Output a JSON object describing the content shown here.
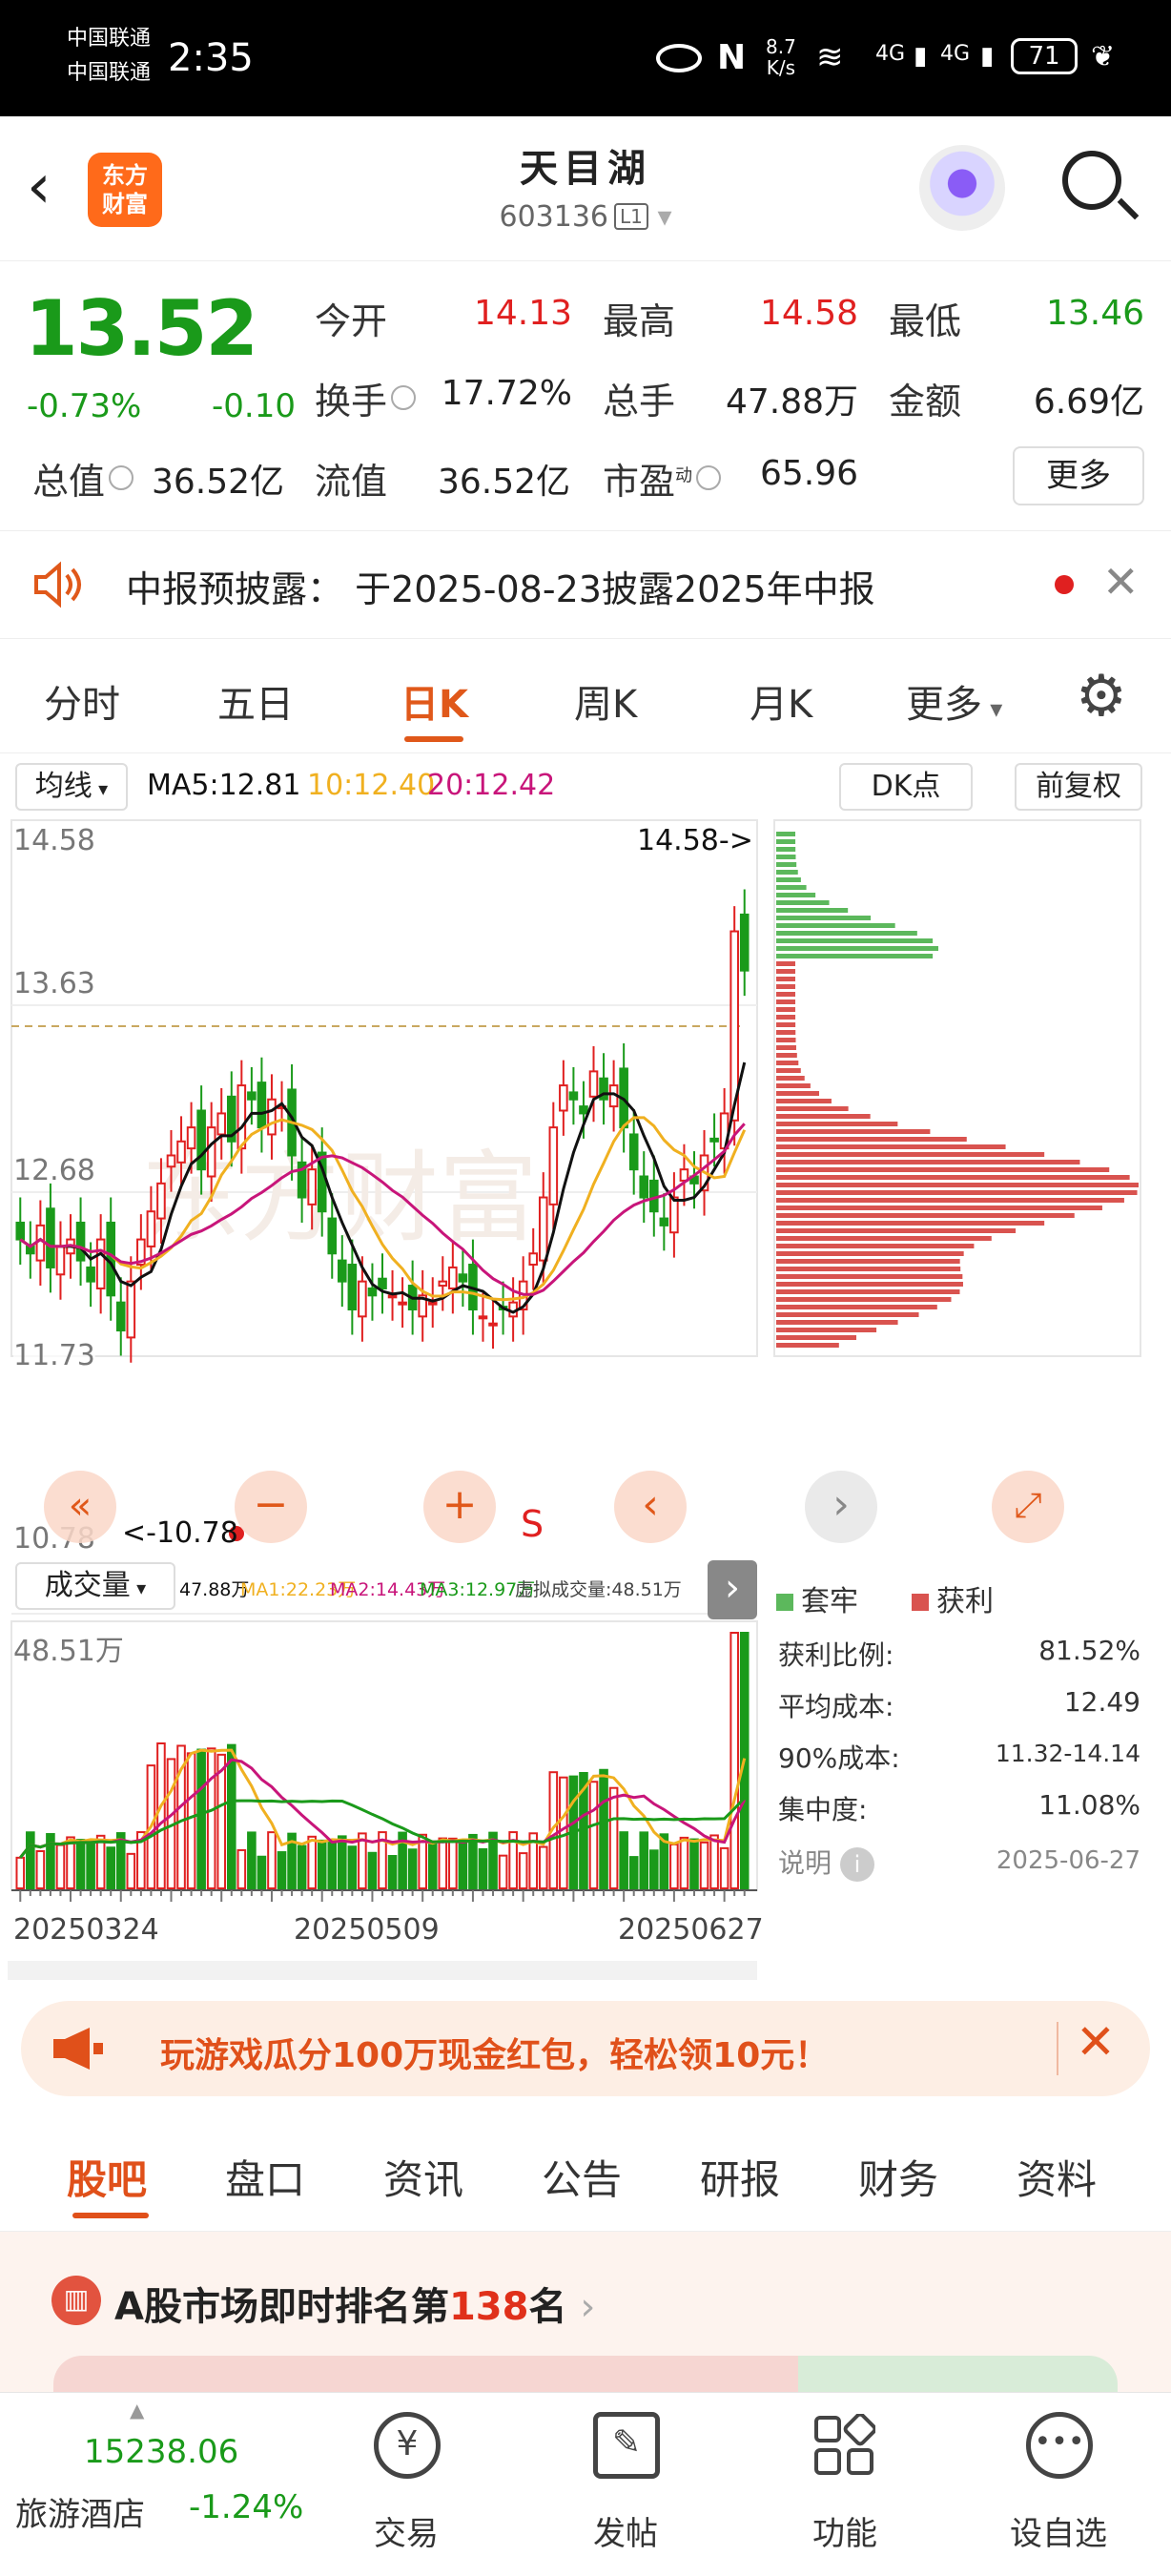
{
  "status_bar": {
    "carrier1": "中国联通",
    "carrier2": "中国联通",
    "time": "2:35",
    "speed": "8.7",
    "speed_unit": "K/s",
    "sig1": "4G",
    "sig2": "4G",
    "battery": "71"
  },
  "header": {
    "stock_name": "天目湖",
    "stock_code": "603136",
    "level": "L1",
    "logo_line1": "东方",
    "logo_line2": "财富"
  },
  "quote": {
    "price": "13.52",
    "pct": "-0.73%",
    "change": "-0.10",
    "open_label": "今开",
    "open": "14.13",
    "high_label": "最高",
    "high": "14.58",
    "low_label": "最低",
    "low": "13.46",
    "turnover_label": "换手",
    "turnover": "17.72%",
    "volume_label": "总手",
    "volume": "47.88万",
    "amount_label": "金额",
    "amount": "6.69亿",
    "mktcap_label": "总值",
    "mktcap": "36.52亿",
    "float_label": "流值",
    "float": "36.52亿",
    "pe_label": "市盈",
    "pe_sup": "动",
    "pe": "65.96",
    "more": "更多"
  },
  "notice": {
    "text": "中报预披露：  于2025-08-23披露2025年中报"
  },
  "tabs": [
    "分时",
    "五日",
    "日K",
    "周K",
    "月K",
    "更多"
  ],
  "active_tab": "日K",
  "chart": {
    "ma_selector": "均线",
    "ma5": "MA5:12.81",
    "ma10": "10:12.40",
    "ma20": "20:12.42",
    "dk": "DK点",
    "fq": "前复权",
    "y_top": "14.58",
    "y2": "13.63",
    "y3": "12.68",
    "y4": "11.73",
    "y_bottom": "10.78",
    "high_marker": "14.58->",
    "low_marker": "<-10.78",
    "s_marker": "S",
    "vol_selector": "成交量",
    "vol_value": "47.88万",
    "vol_ma1": "MA1:22.23万",
    "vol_ma2": "MA2:14.43万",
    "vol_ma3": "MA3:12.97万",
    "vol_sim": "虚拟成交量:48.51万",
    "vol_max": "48.51万",
    "dates": [
      "20250324",
      "20250509",
      "20250627"
    ],
    "legend_trapped": "套牢",
    "legend_profit": "获利",
    "profit_ratio_label": "获利比例:",
    "profit_ratio": "81.52%",
    "avg_cost_label": "平均成本:",
    "avg_cost": "12.49",
    "cost90_label": "90%成本:",
    "cost90": "11.32-14.14",
    "concentration_label": "集中度:",
    "concentration": "11.08%",
    "note_label": "说明",
    "note_date": "2025-06-27"
  },
  "colors": {
    "up": "#e02020",
    "down": "#1a9a1a",
    "ma5": "#111111",
    "ma10": "#f0b020",
    "ma20": "#c8157a",
    "accent": "#e0581a"
  },
  "banner": {
    "text": "玩游戏瓜分100万现金红包，轻松领10元！"
  },
  "tabs2": [
    "股吧",
    "盘口",
    "资讯",
    "公告",
    "研报",
    "财务",
    "资料"
  ],
  "active_tab2": "股吧",
  "rank": {
    "prefix": "A股市场即时排名第",
    "number": "138",
    "suffix": "名"
  },
  "bottom_nav": {
    "index_value": "15238.06",
    "index_name": "旅游酒店",
    "index_pct": "-1.24%",
    "trade": "交易",
    "post": "发帖",
    "func": "功能",
    "watch": "设自选"
  }
}
